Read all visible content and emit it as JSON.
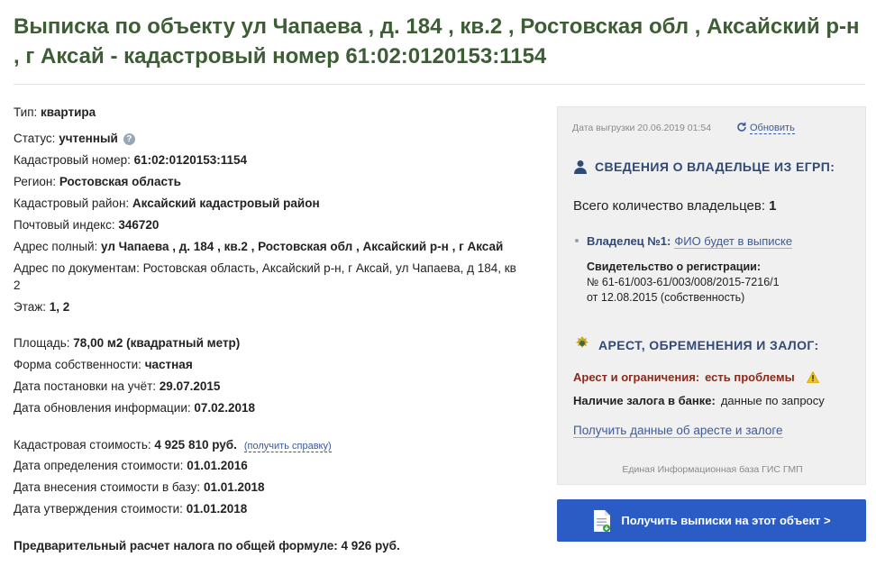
{
  "header": {
    "title": "Выписка по объекту ул Чапаева , д. 184 , кв.2 , Ростовская обл , Аксайский р-н , г Аксай - кадастровый номер 61:02:0120153:1154"
  },
  "info": {
    "type": {
      "label": "Тип:",
      "value": "квартира"
    },
    "status": {
      "label": "Статус:",
      "value": "учтенный",
      "help_icon": "?"
    },
    "cadastral_number": {
      "label": "Кадастровый номер:",
      "value": "61:02:0120153:1154"
    },
    "region": {
      "label": "Регион:",
      "value": "Ростовская область"
    },
    "cadastral_district": {
      "label": "Кадастровый район:",
      "value": "Аксайский кадастровый район"
    },
    "postal_code": {
      "label": "Почтовый индекс:",
      "value": "346720"
    },
    "full_address": {
      "label": "Адрес полный:",
      "value": "ул Чапаева , д. 184 , кв.2 , Ростовская обл , Аксайский р-н , г Аксай"
    },
    "doc_address": {
      "label": "Адрес по документам:",
      "value": "Ростовская область, Аксайский р-н, г Аксай, ул Чапаева, д 184, кв 2"
    },
    "floor": {
      "label": "Этаж:",
      "value": "1, 2"
    },
    "area": {
      "label": "Площадь:",
      "value": "78,00 м2 (квадратный метр)"
    },
    "ownership_form": {
      "label": "Форма собственности:",
      "value": "частная"
    },
    "registration_date": {
      "label": "Дата постановки на учёт:",
      "value": "29.07.2015"
    },
    "update_date": {
      "label": "Дата обновления информации:",
      "value": "07.02.2018"
    },
    "cadastral_value": {
      "label": "Кадастровая стоимость:",
      "value": "4 925 810 руб.",
      "link": "(получить справку)"
    },
    "value_determination_date": {
      "label": "Дата определения стоимости:",
      "value": "01.01.2016"
    },
    "value_entry_date": {
      "label": "Дата внесения стоимости в базу:",
      "value": "01.01.2018"
    },
    "value_approval_date": {
      "label": "Дата утверждения стоимости:",
      "value": "01.01.2018"
    },
    "tax_estimate": {
      "label": "Предварительный расчет налога по общей формуле:",
      "value": "4 926 руб."
    }
  },
  "panel": {
    "export_date": "Дата выгрузки 20.06.2019 01:54",
    "refresh_label": "Обновить",
    "owner_section_title": "СВЕДЕНИЯ О ВЛАДЕЛЬЦЕ ИЗ ЕГРП:",
    "owners_count_label": "Всего количество владельцев:",
    "owners_count_value": "1",
    "owner_label": "Владелец №1:",
    "owner_link": "ФИО будет в выписке",
    "cert_label": "Свидетельство о регистрации:",
    "cert_line1": "№ 61-61/003-61/003/008/2015-7216/1",
    "cert_line2": "от 12.08.2015 (собственность)",
    "arrest_section_title": "АРЕСТ, ОБРЕМЕНЕНИЯ И ЗАЛОГ:",
    "arrest_label": "Арест и ограничения:",
    "arrest_value": "есть проблемы",
    "pledge_label": "Наличие залога в банке:",
    "pledge_value": "данные по запросу",
    "arrest_link": "Получить данные об аресте и залоге",
    "footer_note": "Единая Информационная база ГИС ГМП"
  },
  "cta": {
    "label": "Получить выписки на этот объект >"
  },
  "colors": {
    "title": "#3d5d34",
    "accent_blue": "#2b5cc6",
    "section_head": "#2f4a77",
    "warning": "#8a2a1a"
  }
}
